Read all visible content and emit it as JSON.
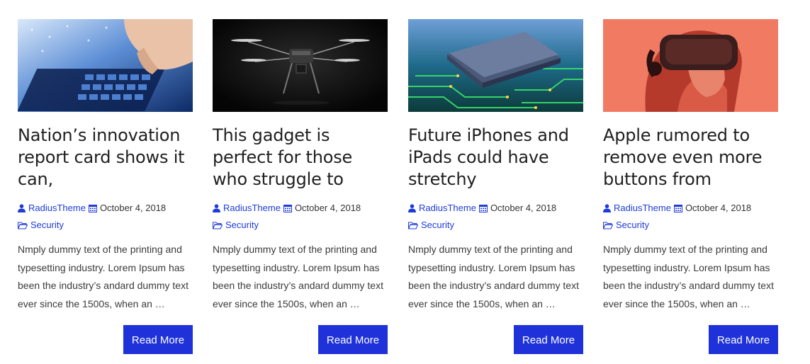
{
  "posts": [
    {
      "image": "keyboard-photo",
      "title": "Nation’s innovation report card shows it can,",
      "author": "RadiusTheme",
      "date": "October 4, 2018",
      "category": "Security",
      "excerpt": "Nmply dummy text of the printing and typesetting industry. Lorem Ipsum has been the industry’s andard dummy text ever since the 1500s, when an …",
      "button": "Read More"
    },
    {
      "image": "drone-photo",
      "title": "This gadget is perfect for those who struggle to",
      "author": "RadiusTheme",
      "date": "October 4, 2018",
      "category": "Security",
      "excerpt": "Nmply dummy text of the printing and typesetting industry. Lorem Ipsum has been the industry’s andard dummy text ever since the 1500s, when an …",
      "button": "Read More"
    },
    {
      "image": "chip-photo",
      "title": "Future iPhones and iPads could have stretchy",
      "author": "RadiusTheme",
      "date": "October 4, 2018",
      "category": "Security",
      "excerpt": "Nmply dummy text of the printing and typesetting industry. Lorem Ipsum has been the industry’s andard dummy text ever since the 1500s, when an …",
      "button": "Read More"
    },
    {
      "image": "vr-headset-photo",
      "title": "Apple rumored to remove even more buttons from",
      "author": "RadiusTheme",
      "date": "October 4, 2018",
      "category": "Security",
      "excerpt": "Nmply dummy text of the printing and typesetting industry. Lorem Ipsum has been the industry’s andard dummy text ever since the 1500s, when an …",
      "button": "Read More"
    }
  ],
  "colors": {
    "accent": "#1f32d9",
    "link": "#1f3bd6",
    "title": "#1f1f1f",
    "text": "#3b3b3b"
  },
  "icons": {
    "author": "user-icon",
    "date": "calendar-icon",
    "category": "folder-open-icon"
  }
}
